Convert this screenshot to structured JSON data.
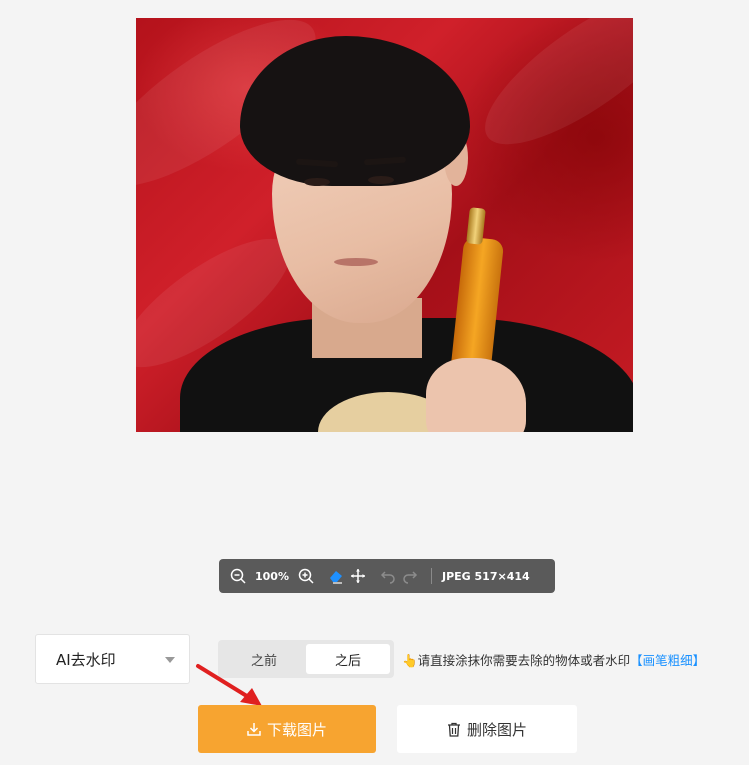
{
  "toolbar": {
    "zoom": "100%",
    "image_info": "JPEG 517×414",
    "icons": [
      "zoom-out-icon",
      "zoom-in-icon",
      "eraser-icon",
      "move-icon",
      "undo-icon",
      "redo-icon"
    ],
    "active_tool_color": "#1e90ff"
  },
  "mode_select": {
    "selected": "AI去水印"
  },
  "compare_toggle": {
    "before_label": "之前",
    "after_label": "之后",
    "active": "after"
  },
  "hint": {
    "text": "请直接涂抹你需要去除的物体或者水印",
    "link": "【画笔粗细】"
  },
  "actions": {
    "download_label": "下载图片",
    "delete_label": "删除图片",
    "download_color": "#f7a430"
  },
  "annotation": {
    "arrow_color": "#e02020"
  }
}
